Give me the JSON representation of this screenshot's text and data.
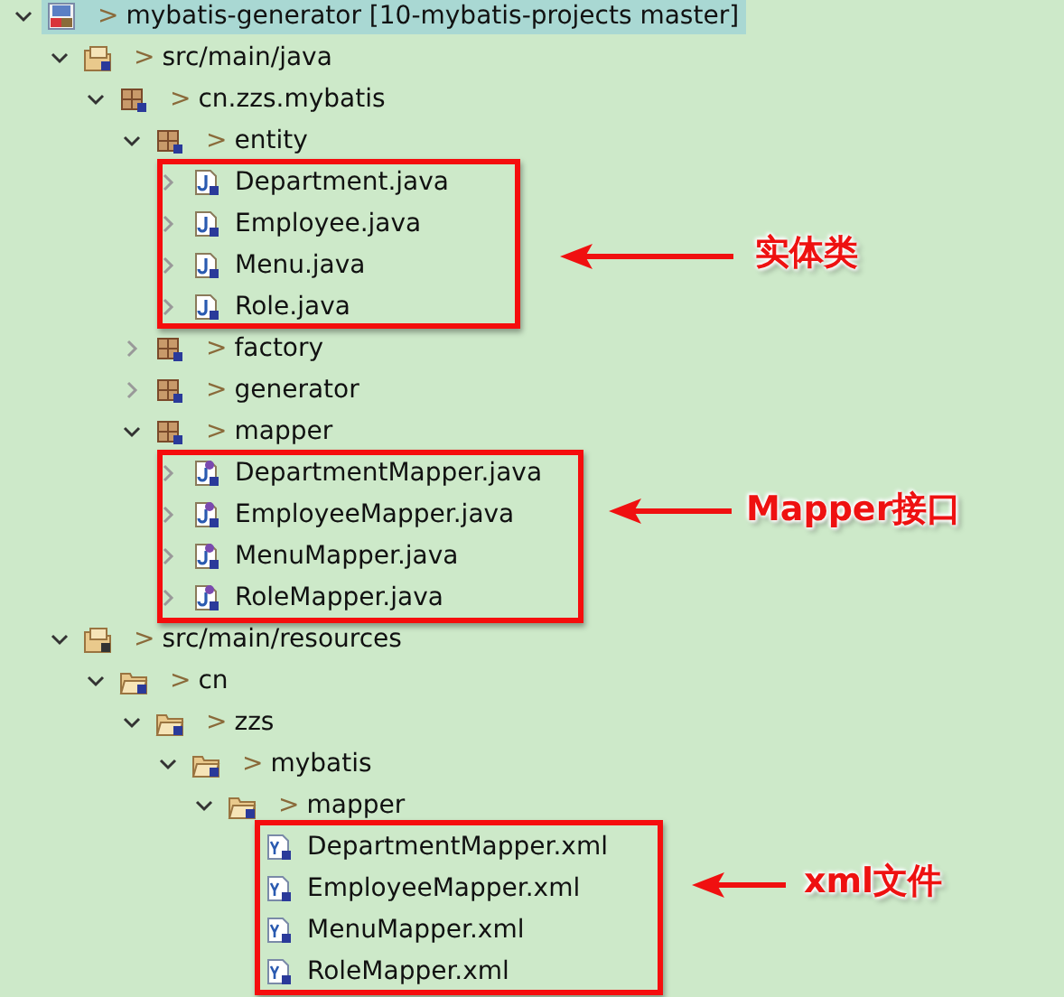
{
  "tree": [
    {
      "kind": "project",
      "decoration": ">",
      "label": "mybatis-generator [10-mybatis-projects master]",
      "selected": true,
      "expanded": true,
      "children": [
        {
          "kind": "source-folder",
          "decoration": ">",
          "label": "src/main/java",
          "selected": false,
          "expanded": true,
          "children": [
            {
              "kind": "package",
              "decoration": ">",
              "label": "cn.zzs.mybatis",
              "selected": false,
              "expanded": true,
              "children": [
                {
                  "kind": "package",
                  "decoration": ">",
                  "label": "entity",
                  "selected": false,
                  "expanded": true,
                  "children": [
                    {
                      "kind": "java-class",
                      "label": "Department.java",
                      "selected": false,
                      "expanded": false
                    },
                    {
                      "kind": "java-class",
                      "label": "Employee.java",
                      "selected": false,
                      "expanded": false
                    },
                    {
                      "kind": "java-class",
                      "label": "Menu.java",
                      "selected": false,
                      "expanded": false
                    },
                    {
                      "kind": "java-class",
                      "label": "Role.java",
                      "selected": false,
                      "expanded": false
                    }
                  ]
                },
                {
                  "kind": "package",
                  "decoration": ">",
                  "label": "factory",
                  "selected": false,
                  "expanded": false
                },
                {
                  "kind": "package",
                  "decoration": ">",
                  "label": "generator",
                  "selected": false,
                  "expanded": false
                },
                {
                  "kind": "package",
                  "decoration": ">",
                  "label": "mapper",
                  "selected": false,
                  "expanded": true,
                  "children": [
                    {
                      "kind": "java-interface",
                      "label": "DepartmentMapper.java",
                      "selected": false,
                      "expanded": false
                    },
                    {
                      "kind": "java-interface",
                      "label": "EmployeeMapper.java",
                      "selected": false,
                      "expanded": false
                    },
                    {
                      "kind": "java-interface",
                      "label": "MenuMapper.java",
                      "selected": false,
                      "expanded": false
                    },
                    {
                      "kind": "java-interface",
                      "label": "RoleMapper.java",
                      "selected": false,
                      "expanded": false
                    }
                  ]
                }
              ]
            }
          ]
        },
        {
          "kind": "resource-folder",
          "decoration": ">",
          "label": "src/main/resources",
          "selected": false,
          "expanded": true,
          "children": [
            {
              "kind": "folder",
              "decoration": ">",
              "label": "cn",
              "selected": false,
              "expanded": true,
              "children": [
                {
                  "kind": "folder",
                  "decoration": ">",
                  "label": "zzs",
                  "selected": false,
                  "expanded": true,
                  "children": [
                    {
                      "kind": "folder",
                      "decoration": ">",
                      "label": "mybatis",
                      "selected": false,
                      "expanded": true,
                      "children": [
                        {
                          "kind": "folder",
                          "decoration": ">",
                          "label": "mapper",
                          "selected": false,
                          "expanded": true,
                          "children": [
                            {
                              "kind": "xml-file",
                              "label": "DepartmentMapper.xml",
                              "selected": false
                            },
                            {
                              "kind": "xml-file",
                              "label": "EmployeeMapper.xml",
                              "selected": false
                            },
                            {
                              "kind": "xml-file",
                              "label": "MenuMapper.xml",
                              "selected": false
                            },
                            {
                              "kind": "xml-file",
                              "label": "RoleMapper.xml",
                              "selected": false
                            }
                          ]
                        }
                      ]
                    }
                  ]
                }
              ]
            }
          ]
        }
      ]
    }
  ],
  "annotations": [
    {
      "label": "实体类"
    },
    {
      "label": "Mapper接口"
    },
    {
      "label": "xml文件"
    }
  ]
}
